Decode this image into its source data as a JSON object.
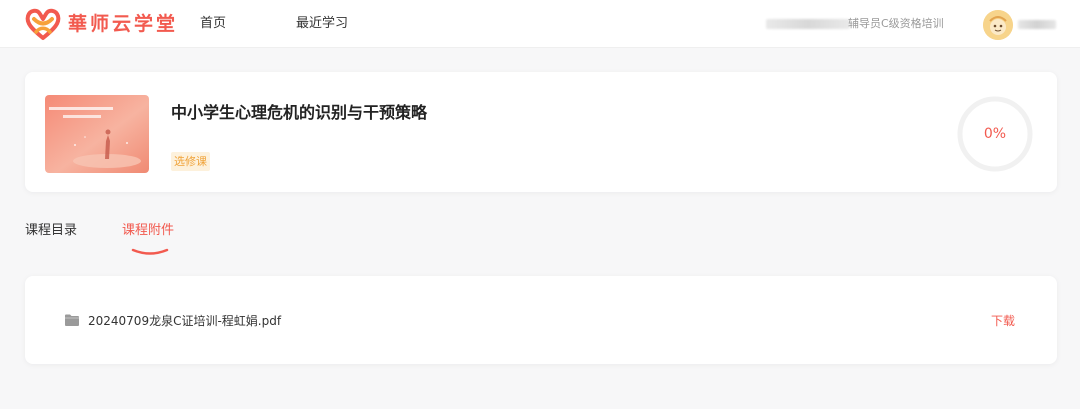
{
  "header": {
    "brand": "華师云学堂",
    "logo_icon": "heart-knot-logo-icon",
    "nav": [
      {
        "label": "首页"
      },
      {
        "label": "最近学习"
      }
    ],
    "org_text": "辅导员C级资格培训",
    "avatar_icon": "cartoon-avatar-icon"
  },
  "course": {
    "title": "中小学生心理危机的识别与干预策略",
    "tag": "选修课",
    "progress_value": 0,
    "progress_text": "0%",
    "cover_icon": "course-cover-image"
  },
  "tabs": [
    {
      "label": "课程目录",
      "active": false
    },
    {
      "label": "课程附件",
      "active": true
    }
  ],
  "attachments": [
    {
      "icon": "folder-icon",
      "name": "20240709龙泉C证培训-程虹娟.pdf",
      "action": "下载"
    }
  ],
  "colors": {
    "accent": "#f25a4f",
    "tag_text": "#f0a33a",
    "tag_bg": "#fdf1dc",
    "page_bg": "#f7f7f8"
  }
}
